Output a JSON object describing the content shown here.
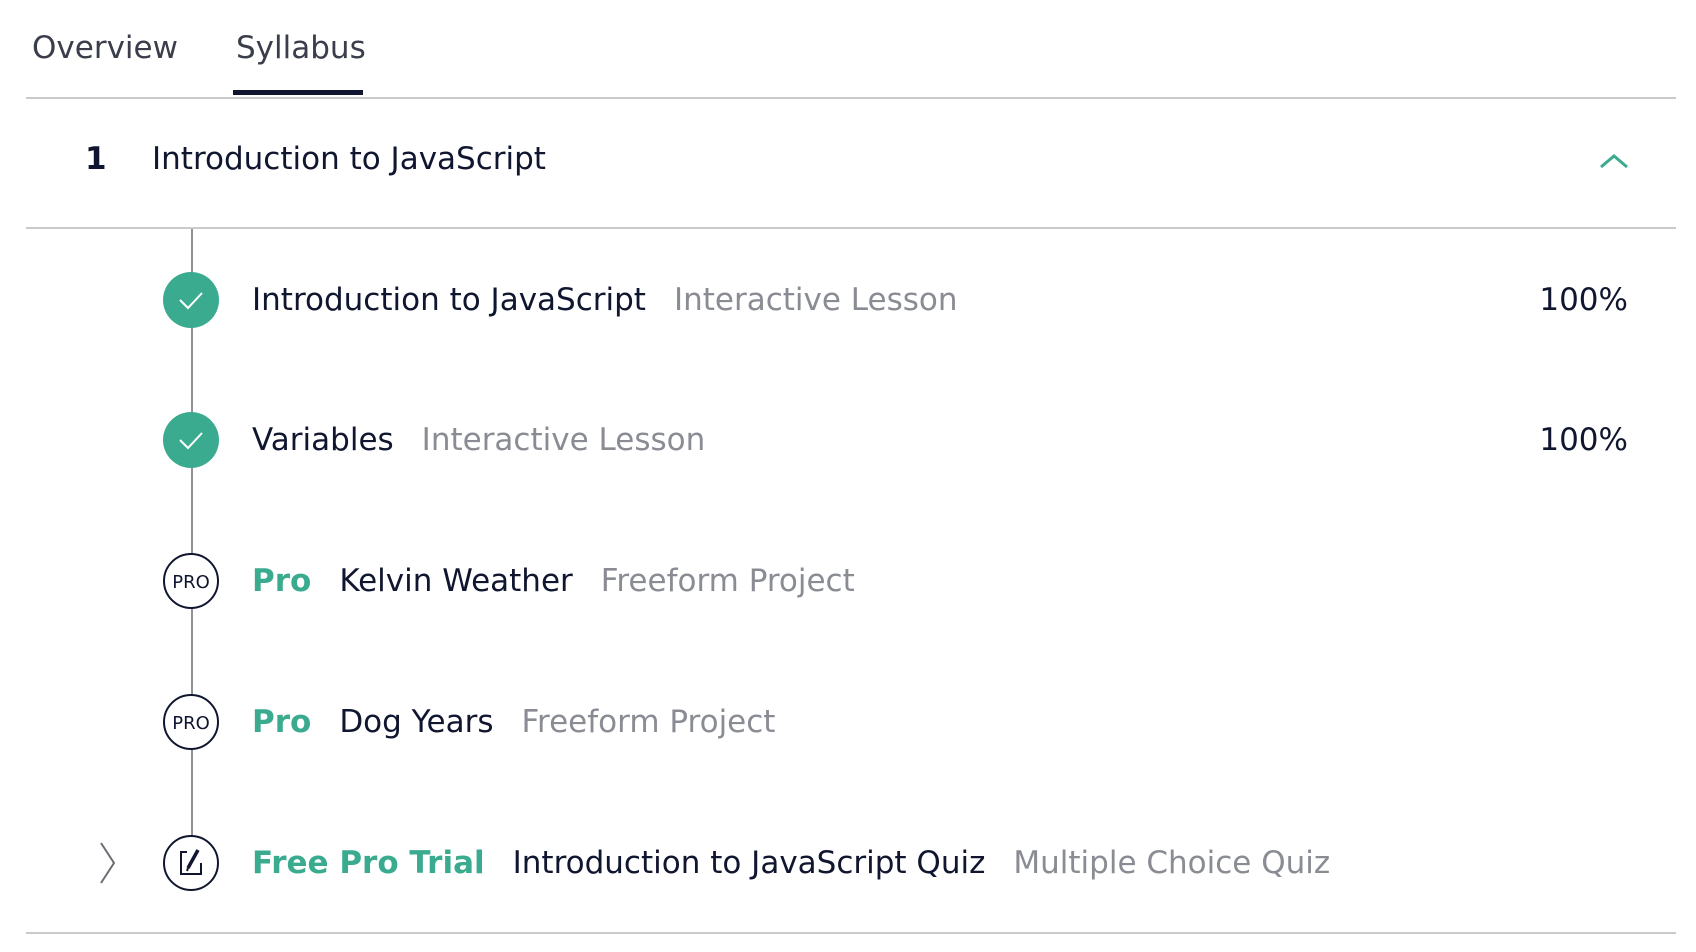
{
  "tabs": [
    {
      "label": "Overview",
      "active": false
    },
    {
      "label": "Syllabus",
      "active": true
    }
  ],
  "section": {
    "number": "1",
    "title": "Introduction to JavaScript",
    "expanded": true,
    "icon": "chevron-up-icon"
  },
  "items": [
    {
      "status": "completed",
      "icon": "check-icon",
      "badge": "",
      "title": "Introduction to JavaScript",
      "type": "Interactive Lesson",
      "progress": "100%"
    },
    {
      "status": "completed",
      "icon": "check-icon",
      "badge": "",
      "title": "Variables",
      "type": "Interactive Lesson",
      "progress": "100%"
    },
    {
      "status": "pro",
      "icon": "pro-badge-icon",
      "icon_text": "PRO",
      "badge": "Pro",
      "title": "Kelvin Weather",
      "type": "Freeform Project",
      "progress": ""
    },
    {
      "status": "pro",
      "icon": "pro-badge-icon",
      "icon_text": "PRO",
      "badge": "Pro",
      "title": "Dog Years",
      "type": "Freeform Project",
      "progress": ""
    },
    {
      "status": "quiz",
      "icon": "quiz-edit-icon",
      "badge": "Free Pro Trial",
      "title": "Introduction to JavaScript Quiz",
      "type": "Multiple Choice Quiz",
      "progress": ""
    }
  ],
  "colors": {
    "accent": "#3bab8f",
    "text": "#10162f",
    "muted": "#8a8c94",
    "divider": "#c8cacc"
  }
}
